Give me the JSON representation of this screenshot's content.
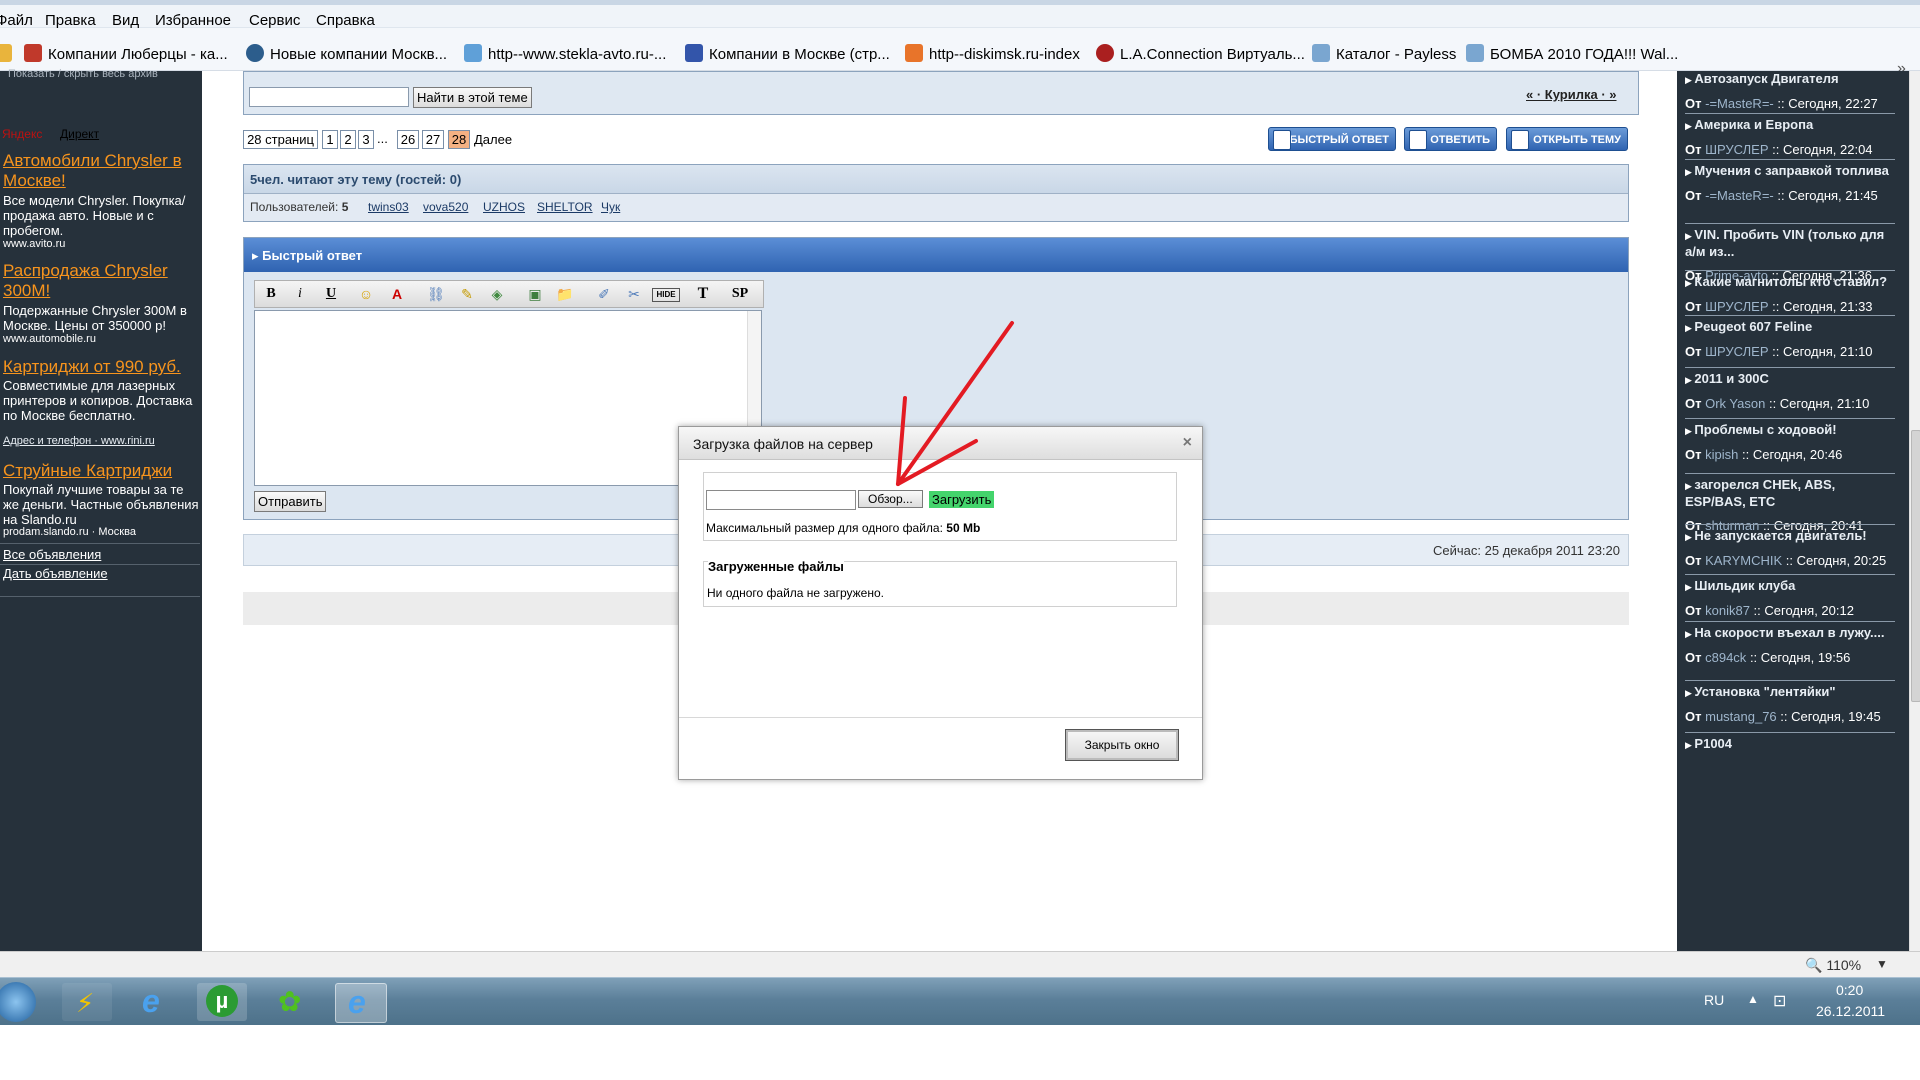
{
  "menu": [
    "Файл",
    "Правка",
    "Вид",
    "Избранное",
    "Сервис",
    "Справка"
  ],
  "favorites": [
    "Компании Люберцы - ка...",
    "Новые компании Москв...",
    "http--www.stekla-avto.ru-...",
    "Компании в Москве (стр...",
    "http--diskimsk.ru-index",
    "L.A.Connection Виртуаль...",
    "Каталог - Payless",
    "БОМБА 2010 ГОДА!!! Wal..."
  ],
  "favorites_more": "»",
  "left_ads": {
    "archive_toggle": "Показать / скрыть весь архив",
    "yandex": "Яндекс",
    "direct": "Директ",
    "ads": [
      {
        "title": "Автомобили Chrysler в Москве!",
        "text": "Все модели Chrysler. Покупка/продажа авто. Новые и с пробегом.",
        "src": "www.avito.ru"
      },
      {
        "title": "Распродажа Chrysler 300M!",
        "text": "Подержанные Chrysler 300M в Москве. Цены от 350000 р!",
        "src": "www.automobile.ru"
      },
      {
        "title": "Картриджи от 990 руб.",
        "text": "Совместимые для лазерных принтеров и копиров. Доставка по Москве бесплатно.",
        "src": "Адрес и телефон · www.rini.ru"
      },
      {
        "title": "Струйные Картриджи",
        "text": "Покупай лучшие товары за те же деньги. Частные объявления на Slando.ru",
        "src": "prodam.slando.ru · Москва"
      }
    ],
    "all_ads": "Все объявления",
    "give_ad": "Дать объявление"
  },
  "topic": {
    "search_placeholder": "",
    "search_button": "Найти в этой теме",
    "nav": "« · Курилка · »",
    "pages_label": "28 страниц",
    "pages": [
      "1",
      "2",
      "3",
      "...",
      "26",
      "27",
      "28"
    ],
    "next": "Далее",
    "btn_quick": "БЫСТРЫЙ ОТВЕТ",
    "btn_reply": "ОТВЕТИТЬ",
    "btn_new": "ОТКРЫТЬ ТЕМУ",
    "readers": "5чел. читают эту тему (гостей: 0)",
    "users_prefix": "Пользователей:",
    "users_count": "5",
    "users": [
      "twins03",
      "vova520",
      "UZHOS",
      "SHELTOR",
      "Чук"
    ],
    "quick_reply_title": "Быстрый ответ",
    "toolbar": [
      "B",
      "i",
      "U",
      "☺",
      "A",
      "⛓",
      "✎",
      "◈",
      "▣",
      "📁",
      "✐",
      "✂",
      "HIDE",
      "T",
      "SP"
    ],
    "send": "Отправить",
    "now": "Сейчас: 25 декабря 2011 23:20"
  },
  "modal": {
    "title": "Загрузка файлов на сервер",
    "close_x": "×",
    "browse": "Обзор...",
    "upload": "Загрузить",
    "max_size_label": "Максимальный размер для одного файла:",
    "max_size_value": "50 Mb",
    "uploaded_title": "Загруженные файлы",
    "no_files": "Ни одного файла не загружено.",
    "close_window": "Закрыть окно"
  },
  "right_sidebar": [
    {
      "title": "Автозапуск Двигателя",
      "from": "От",
      "user": "-=MasteR=-",
      "time": ":: Сегодня, 22:27"
    },
    {
      "title": "Америка и Европа",
      "from": "От",
      "user": "ШРУСЛЕР",
      "time": ":: Сегодня, 22:04"
    },
    {
      "title": "Мучения с заправкой топлива",
      "from": "От",
      "user": "-=MasteR=-",
      "time": ":: Сегодня, 21:45"
    },
    {
      "title": "VIN. Пробить VIN (только для а/м из...",
      "from": "От",
      "user": "Prime-avto",
      "time": ":: Сегодня, 21:36"
    },
    {
      "title": "Какие магнитолы кто ставил?",
      "from": "От",
      "user": "ШРУСЛЕР",
      "time": ":: Сегодня, 21:33"
    },
    {
      "title": "Peugeot 607 Feline",
      "from": "От",
      "user": "ШРУСЛЕР",
      "time": ":: Сегодня, 21:10"
    },
    {
      "title": "2011 и 300С",
      "from": "От",
      "user": "Ork Yason",
      "time": ":: Сегодня, 21:10"
    },
    {
      "title": "Проблемы с ходовой!",
      "from": "От",
      "user": "kipish",
      "time": ":: Сегодня, 20:46"
    },
    {
      "title": "загорелся CHEk, ABS, ESP/BAS, ETC",
      "from": "От",
      "user": "shturman",
      "time": ":: Сегодня, 20:41"
    },
    {
      "title": "Не запускается двигатель!",
      "from": "От",
      "user": "KARYMCHIK",
      "time": ":: Сегодня, 20:25"
    },
    {
      "title": "Шильдик клуба",
      "from": "От",
      "user": "konik87",
      "time": ":: Сегодня, 20:12"
    },
    {
      "title": "На скорости въехал в лужу....",
      "from": "От",
      "user": "c894ck",
      "time": ":: Сегодня, 19:56"
    },
    {
      "title": "Установка \"лентяйки\"",
      "from": "От",
      "user": "mustang_76",
      "time": ":: Сегодня, 19:45"
    },
    {
      "title": "P1004",
      "from": "",
      "user": "",
      "time": ""
    }
  ],
  "status": {
    "zoom": "110%"
  },
  "taskbar": {
    "lang": "RU",
    "time": "0:20",
    "date": "26.12.2011"
  },
  "colors": {
    "accent_orange": "#f7941d",
    "sidebar_bg": "#26313b",
    "header_blue": "#3e72c0",
    "upload_green": "#44d46c"
  }
}
